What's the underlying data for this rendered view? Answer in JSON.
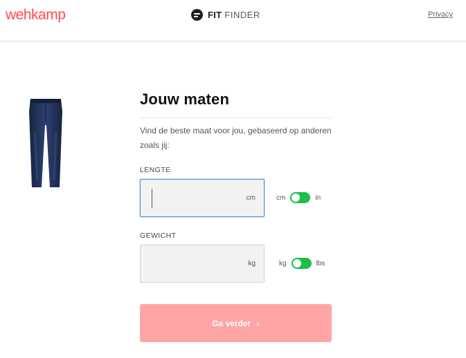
{
  "header": {
    "brand": "wehkamp",
    "widget_name_bold": "FIT",
    "widget_name_light": "FINDER",
    "privacy_link": "Privacy"
  },
  "product": {
    "image_icon": "jeans-image",
    "color": "#1f2d4d"
  },
  "form": {
    "title": "Jouw maten",
    "description": "Vind de beste maat voor jou, gebaseerd op anderen zoals jij:",
    "height": {
      "label": "LENGTE",
      "value": "",
      "unit": "cm",
      "toggle_left": "cm",
      "toggle_right": "in"
    },
    "weight": {
      "label": "GEWICHT",
      "value": "",
      "unit": "kg",
      "toggle_left": "kg",
      "toggle_right": "lbs"
    },
    "submit_label": "Ga verder",
    "submit_icon": "chevron-right-icon"
  },
  "colors": {
    "brand": "#ff4b4b",
    "toggle": "#1bbf4a",
    "cta_disabled": "#ffa5a8",
    "focus": "#4a90e2"
  }
}
